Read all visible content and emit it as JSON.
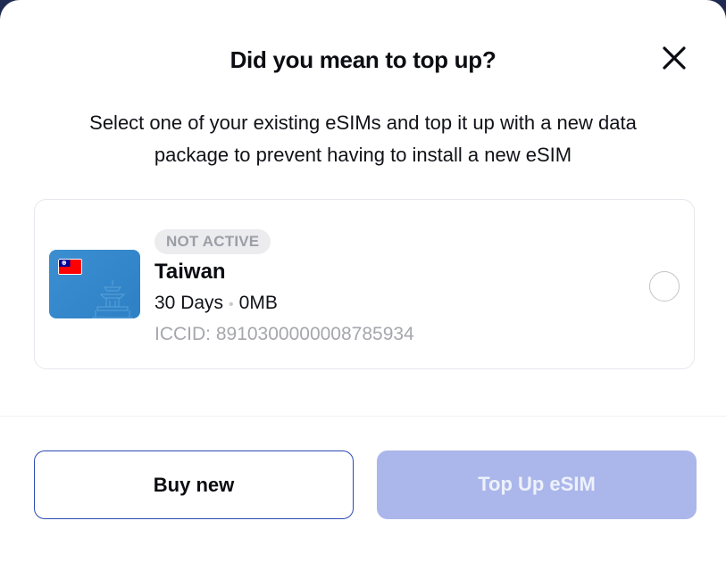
{
  "dialog": {
    "title": "Did you mean to top up?",
    "subtitle_line1": "Select one of your existing eSIMs and top it up with a new data",
    "subtitle_line2": "package to prevent having to install a new eSIM",
    "close_icon": "close-icon"
  },
  "esim": {
    "status": "NOT ACTIVE",
    "country": "Taiwan",
    "duration": "30 Days",
    "separator": "•",
    "data": "0MB",
    "iccid": "ICCID: 8910300000008785934",
    "flag_icon": "taiwan-flag-icon",
    "selected": false
  },
  "actions": {
    "buy_new": "Buy new",
    "top_up": "Top Up eSIM"
  },
  "colors": {
    "primary_border": "#2d4bb5",
    "disabled_primary": "#abb7ea",
    "card_blue": "#3b8fd1"
  }
}
